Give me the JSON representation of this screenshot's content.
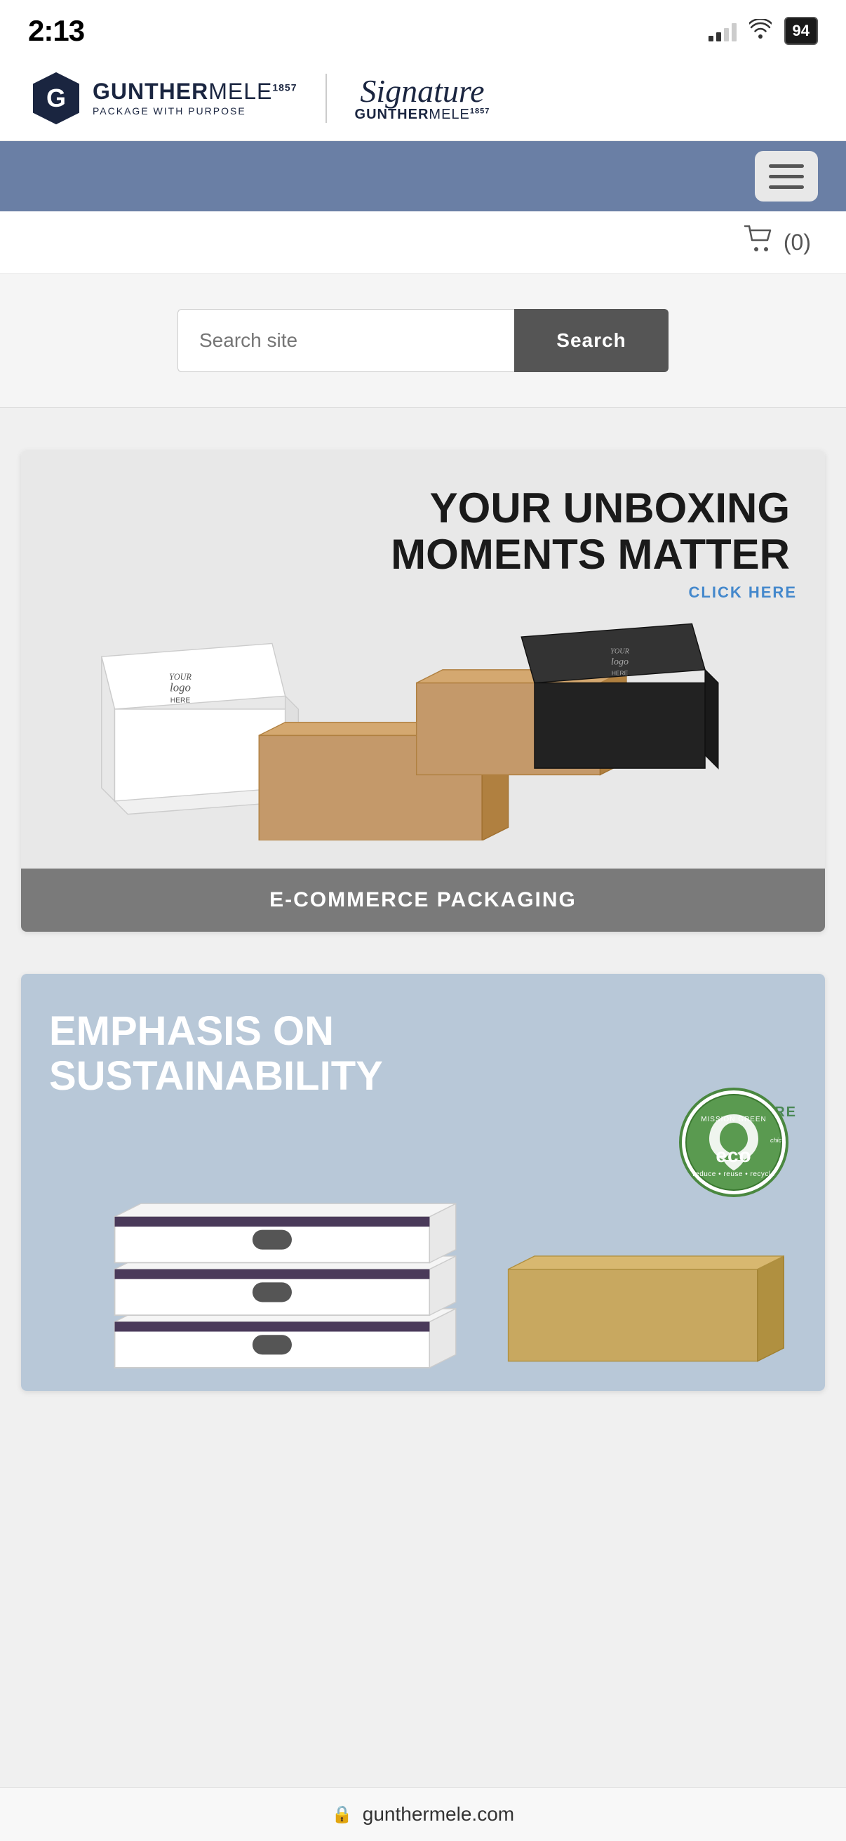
{
  "statusBar": {
    "time": "2:13",
    "battery": "94"
  },
  "header": {
    "brandName": "GUNTHER",
    "brandNameScript": "MELE",
    "brandYear": "1857",
    "tagline": "PACKAGE WITH PURPOSE",
    "signatureText": "Signature",
    "signatureBrand": "GUNTHER",
    "signatureMele": "MELE",
    "signatureYear": "1857"
  },
  "nav": {
    "menuButton": "☰"
  },
  "cart": {
    "count": "(0)"
  },
  "search": {
    "placeholder": "Search site",
    "buttonLabel": "Search"
  },
  "banners": [
    {
      "id": "ecommerce",
      "title": "YOUR UNBOXING\nMOMENTS MATTER",
      "cta": "CLICK HERE",
      "footer": "E-COMMERCE PACKAGING"
    },
    {
      "id": "sustainability",
      "title": "EMPHASIS ON\nSUSTAINABILITY",
      "cta": "CLICK HERE",
      "ecoBadge": "ECO"
    }
  ],
  "bottomBar": {
    "domain": "gunthermele.com",
    "lockIcon": "🔒"
  }
}
